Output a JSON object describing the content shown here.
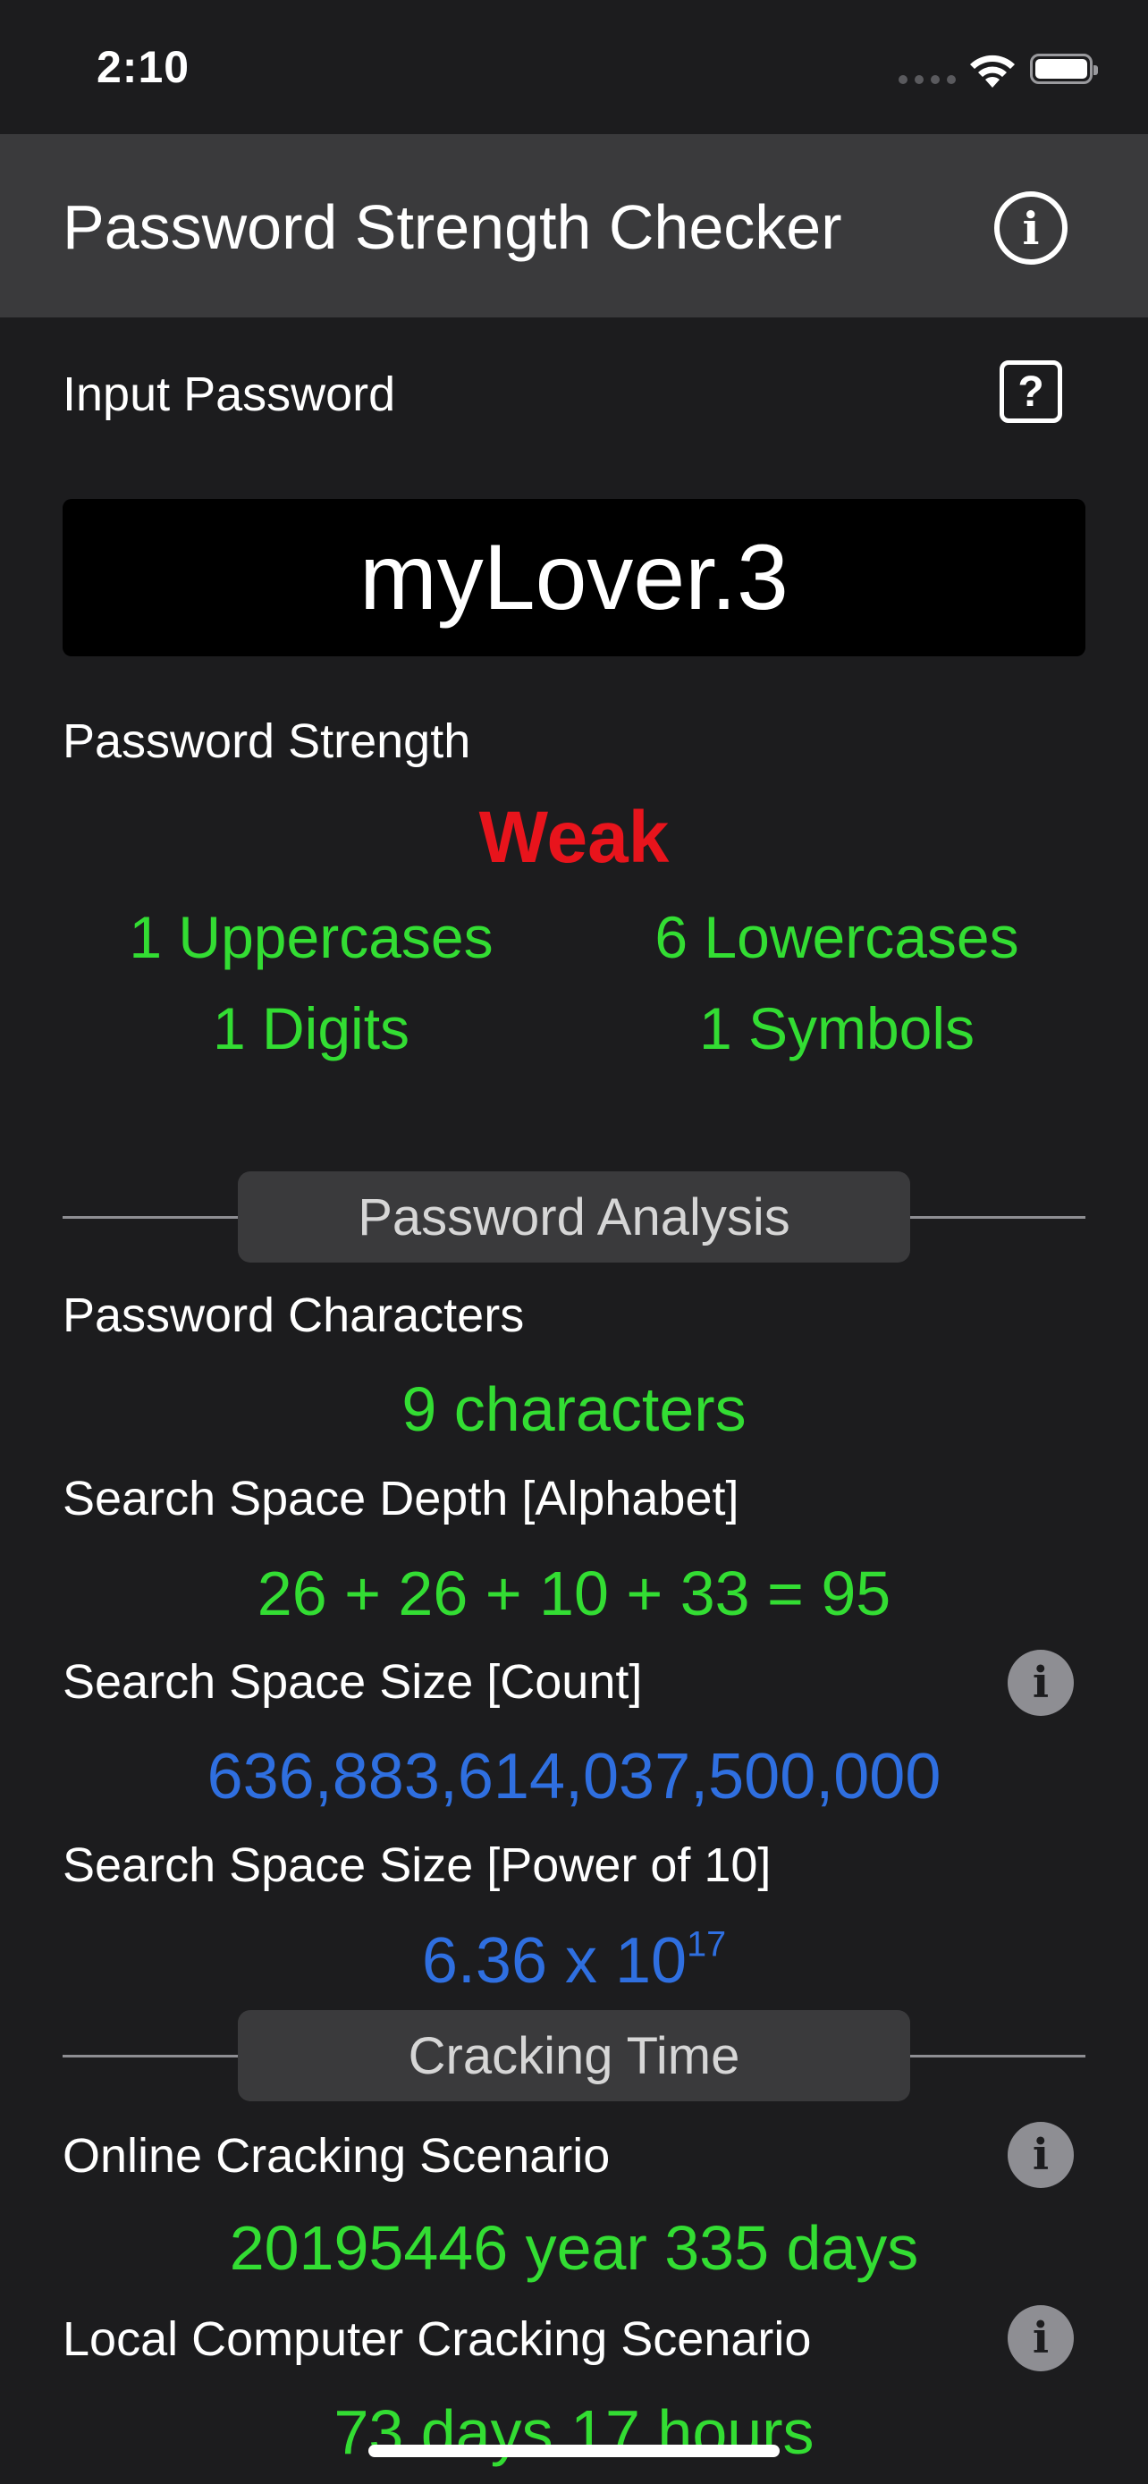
{
  "status_bar": {
    "time": "2:10"
  },
  "nav": {
    "title": "Password Strength Checker"
  },
  "input": {
    "label": "Input Password",
    "value": "myLover.3"
  },
  "strength": {
    "label": "Password Strength",
    "value": "Weak",
    "value_color": "#e8141c",
    "uppercase": "1 Uppercases",
    "lowercase": "6 Lowercases",
    "digits": "1 Digits",
    "symbols": "1 Symbols"
  },
  "analysis": {
    "section_title": "Password Analysis",
    "characters_label": "Password Characters",
    "characters_value": "9 characters",
    "depth_label": "Search Space Depth [Alphabet]",
    "depth_value": "26 + 26 + 10 + 33 = 95",
    "count_label": "Search Space Size [Count]",
    "count_value": "636,883,614,037,500,000",
    "power_label": "Search Space Size [Power of 10]",
    "power_base": "6.36 x 10",
    "power_exponent": "17"
  },
  "cracking": {
    "section_title": "Cracking Time",
    "online_label": "Online Cracking Scenario",
    "online_value": "20195446 year 335 days",
    "local_label": "Local Computer Cracking Scenario",
    "local_value": "73 days 17 hours"
  },
  "colors": {
    "background": "#1c1c1e",
    "nav_bar": "#3a3a3c",
    "green": "#33dd33",
    "blue": "#2f6fe0",
    "red": "#e8141c"
  },
  "icons": {
    "nav_info": "info-circle-icon",
    "help": "question-square-icon",
    "row_info": "info-filled-circle-icon"
  }
}
